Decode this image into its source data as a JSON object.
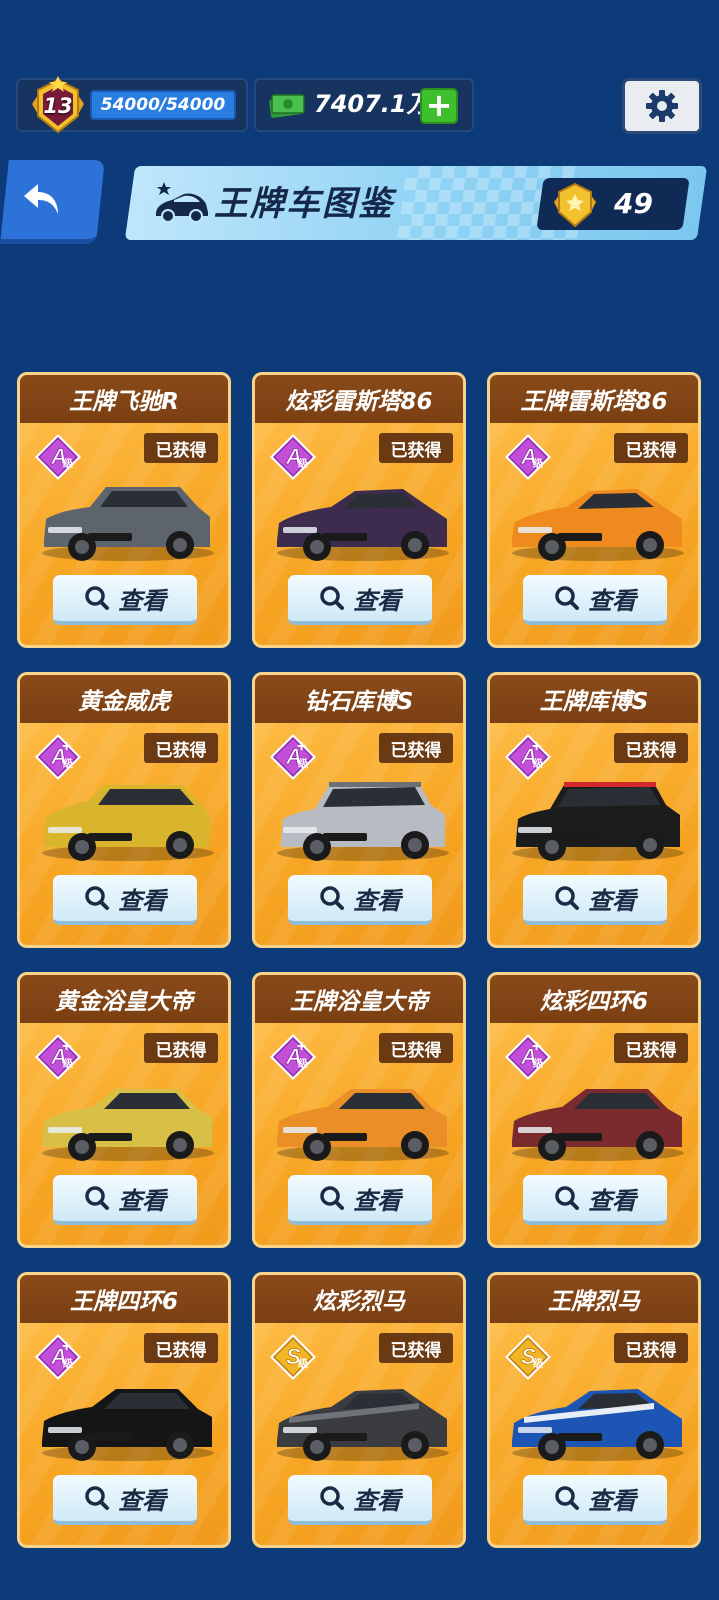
{
  "hud": {
    "level": "13",
    "xp_text": "54000/54000",
    "cash_text": "7407.1万",
    "plus_label": "+"
  },
  "header": {
    "title": "王牌车图鉴",
    "collected_count": "49"
  },
  "colors": {
    "background": "#0d3a78",
    "card": "#f7a624",
    "card_header": "#7a3f12",
    "grade_a": "#c24fd8",
    "grade_s": "#f1b526",
    "view_button": "#e6f5fc"
  },
  "cards": [
    {
      "name": "",
      "grade": "",
      "owned": "",
      "view": "查看",
      "car_color": "#d4b12a",
      "car_accent": "#a88716",
      "style": "beetle"
    },
    {
      "name": "",
      "grade": "",
      "owned": "",
      "view": "查看",
      "car_color": "#d9d3c6",
      "car_accent": "#222222",
      "style": "beetle"
    },
    {
      "name": "",
      "grade": "",
      "owned": "",
      "view": "查看",
      "car_color": "#8c1a22",
      "car_accent": "#5a0c12",
      "style": "hatch"
    },
    {
      "name": "王牌飞驰R",
      "grade": "A",
      "plus": false,
      "owned": "已获得",
      "view": "查看",
      "car_color": "#5e646b",
      "car_accent": "#c9d730",
      "style": "hatch"
    },
    {
      "name": "炫彩雷斯塔86",
      "grade": "A",
      "plus": false,
      "owned": "已获得",
      "view": "查看",
      "car_color": "#3d2c4e",
      "car_accent": "#6b4f86",
      "style": "coupe"
    },
    {
      "name": "王牌雷斯塔86",
      "grade": "A",
      "plus": false,
      "owned": "已获得",
      "view": "查看",
      "car_color": "#ef8a1f",
      "car_accent": "#2a2a2a",
      "style": "coupe"
    },
    {
      "name": "黄金威虎",
      "grade": "A",
      "plus": true,
      "owned": "已获得",
      "view": "查看",
      "car_color": "#d8b52c",
      "car_accent": "#9c7b10",
      "style": "suv"
    },
    {
      "name": "钻石库博S",
      "grade": "A",
      "plus": true,
      "owned": "已获得",
      "view": "查看",
      "car_color": "#b8bcc2",
      "car_accent": "#6c7178",
      "style": "mini"
    },
    {
      "name": "王牌库博S",
      "grade": "A",
      "plus": true,
      "owned": "已获得",
      "view": "查看",
      "car_color": "#1c1c1c",
      "car_accent": "#d12a2a",
      "style": "mini"
    },
    {
      "name": "黄金浴皇大帝",
      "grade": "A",
      "plus": true,
      "owned": "已获得",
      "view": "查看",
      "car_color": "#d8bf45",
      "car_accent": "#a48a18",
      "style": "sedan"
    },
    {
      "name": "王牌浴皇大帝",
      "grade": "A",
      "plus": true,
      "owned": "已获得",
      "view": "查看",
      "car_color": "#ea8f28",
      "car_accent": "#3a3a3a",
      "style": "sedan"
    },
    {
      "name": "炫彩四环6",
      "grade": "A",
      "plus": true,
      "owned": "已获得",
      "view": "查看",
      "car_color": "#7b2a2e",
      "car_accent": "#3b3f46",
      "style": "sedan"
    },
    {
      "name": "王牌四环6",
      "grade": "A",
      "plus": true,
      "owned": "已获得",
      "view": "查看",
      "car_color": "#151515",
      "car_accent": "#444444",
      "style": "sedan"
    },
    {
      "name": "炫彩烈马",
      "grade": "S",
      "plus": false,
      "owned": "已获得",
      "view": "查看",
      "car_color": "#3a3c40",
      "car_accent": "#777a80",
      "style": "muscle"
    },
    {
      "name": "王牌烈马",
      "grade": "S",
      "plus": false,
      "owned": "已获得",
      "view": "查看",
      "car_color": "#1d55b5",
      "car_accent": "#ffffff",
      "style": "muscle"
    }
  ]
}
